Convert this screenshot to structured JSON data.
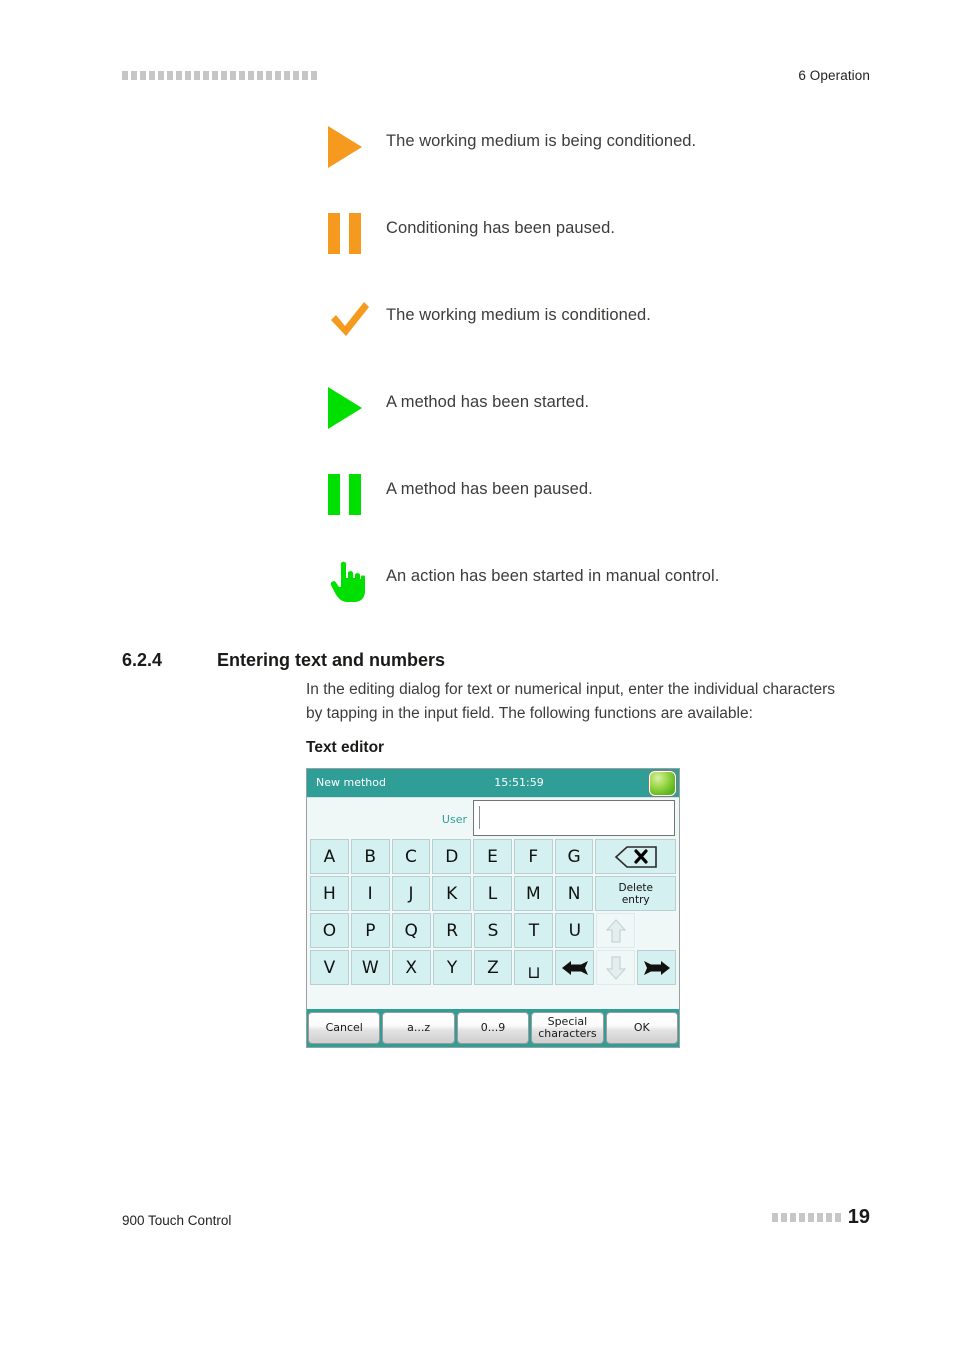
{
  "header": {
    "chapter": "6 Operation",
    "decor_squares": 22
  },
  "legend": {
    "items": [
      {
        "icon": "play-triangle-icon",
        "color": "#f59a1e",
        "text": "The working medium is being conditioned."
      },
      {
        "icon": "pause-bars-icon",
        "color": "#f59a1e",
        "text": "Conditioning has been paused."
      },
      {
        "icon": "checkmark-icon",
        "color": "#f59a1e",
        "text": "The working medium is conditioned."
      },
      {
        "icon": "play-triangle-icon",
        "color": "#00e000",
        "text": "A method has been started."
      },
      {
        "icon": "pause-bars-icon",
        "color": "#00e000",
        "text": "A method has been paused."
      },
      {
        "icon": "pointing-hand-icon",
        "color": "#00e000",
        "text": "An action has been started in manual control."
      }
    ]
  },
  "section": {
    "number": "6.2.4",
    "title": "Entering text and numbers",
    "paragraph": "In the editing dialog for text or numerical input, enter the individual characters by tapping in the input field. The following functions are available:",
    "subheading": "Text editor"
  },
  "device": {
    "titlebar": {
      "name": "New method",
      "time": "15:51:59",
      "status_led": "green-status-led"
    },
    "input": {
      "label": "User",
      "value": ""
    },
    "keypad": {
      "row1": [
        "A",
        "B",
        "C",
        "D",
        "E",
        "F",
        "G"
      ],
      "row1_action": "backspace-icon",
      "row2": [
        "H",
        "I",
        "J",
        "K",
        "L",
        "M",
        "N"
      ],
      "row2_action_line1": "Delete",
      "row2_action_line2": "entry",
      "row3": [
        "O",
        "P",
        "Q",
        "R",
        "S",
        "T",
        "U"
      ],
      "row3_action": "arrow-up-icon",
      "row4": [
        "V",
        "W",
        "X",
        "Y",
        "Z"
      ],
      "row4_space": "space-key",
      "row4_actions": [
        "arrow-left-icon",
        "arrow-down-icon",
        "arrow-right-icon"
      ]
    },
    "buttons": [
      {
        "label": "Cancel"
      },
      {
        "label": "a...z"
      },
      {
        "label": "0...9"
      },
      {
        "label_line1": "Special",
        "label_line2": "characters"
      },
      {
        "label": "OK"
      }
    ],
    "colors": {
      "titlebar": "#2f9e96",
      "key": "#d4f0f0",
      "accent": "#2f9e96"
    }
  },
  "footer": {
    "title": "900 Touch Control",
    "page": "19",
    "decor_squares": 8
  }
}
